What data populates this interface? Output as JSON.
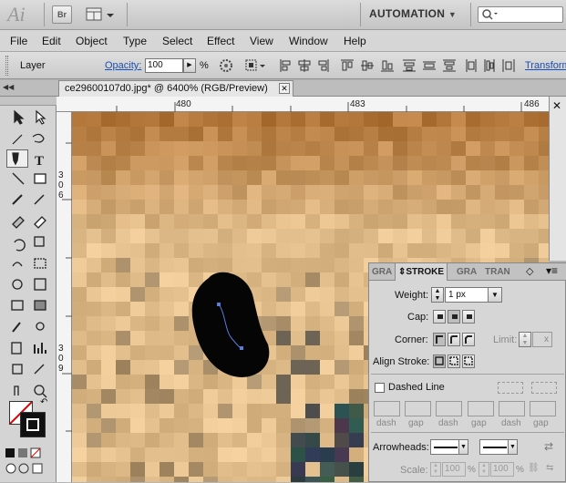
{
  "app": {
    "logo": "Ai",
    "bridge_label": "Br",
    "workspace": "AUTOMATION"
  },
  "menu": [
    "File",
    "Edit",
    "Object",
    "Type",
    "Select",
    "Effect",
    "View",
    "Window",
    "Help"
  ],
  "control_bar": {
    "layer_label": "Layer",
    "opacity_label": "Opacity:",
    "opacity_value": "100",
    "percent": "%",
    "transform_label": "Transform"
  },
  "document_tab": {
    "title": "ce29600107d0.jpg* @ 6400% (RGB/Preview)",
    "close": "✕"
  },
  "rulers": {
    "top": [
      "480",
      "483",
      "486"
    ],
    "left_top": [
      "3",
      "0",
      "6"
    ],
    "left_bottom": [
      "3",
      "0",
      "9"
    ]
  },
  "stroke_panel": {
    "tabs": [
      "GRA",
      "STROKE",
      "GRA",
      "TRAN"
    ],
    "weight_label": "Weight:",
    "weight_value": "1 px",
    "cap_label": "Cap:",
    "corner_label": "Corner:",
    "limit_label": "Limit:",
    "limit_value": "x",
    "align_label": "Align Stroke:",
    "dashed_label": "Dashed Line",
    "dash_labels": [
      "dash",
      "gap",
      "dash",
      "gap",
      "dash",
      "gap"
    ],
    "arrowheads_label": "Arrowheads:",
    "scale_label": "Scale:",
    "scale_value_1": "100",
    "scale_value_2": "100",
    "scale_pct": "%"
  }
}
